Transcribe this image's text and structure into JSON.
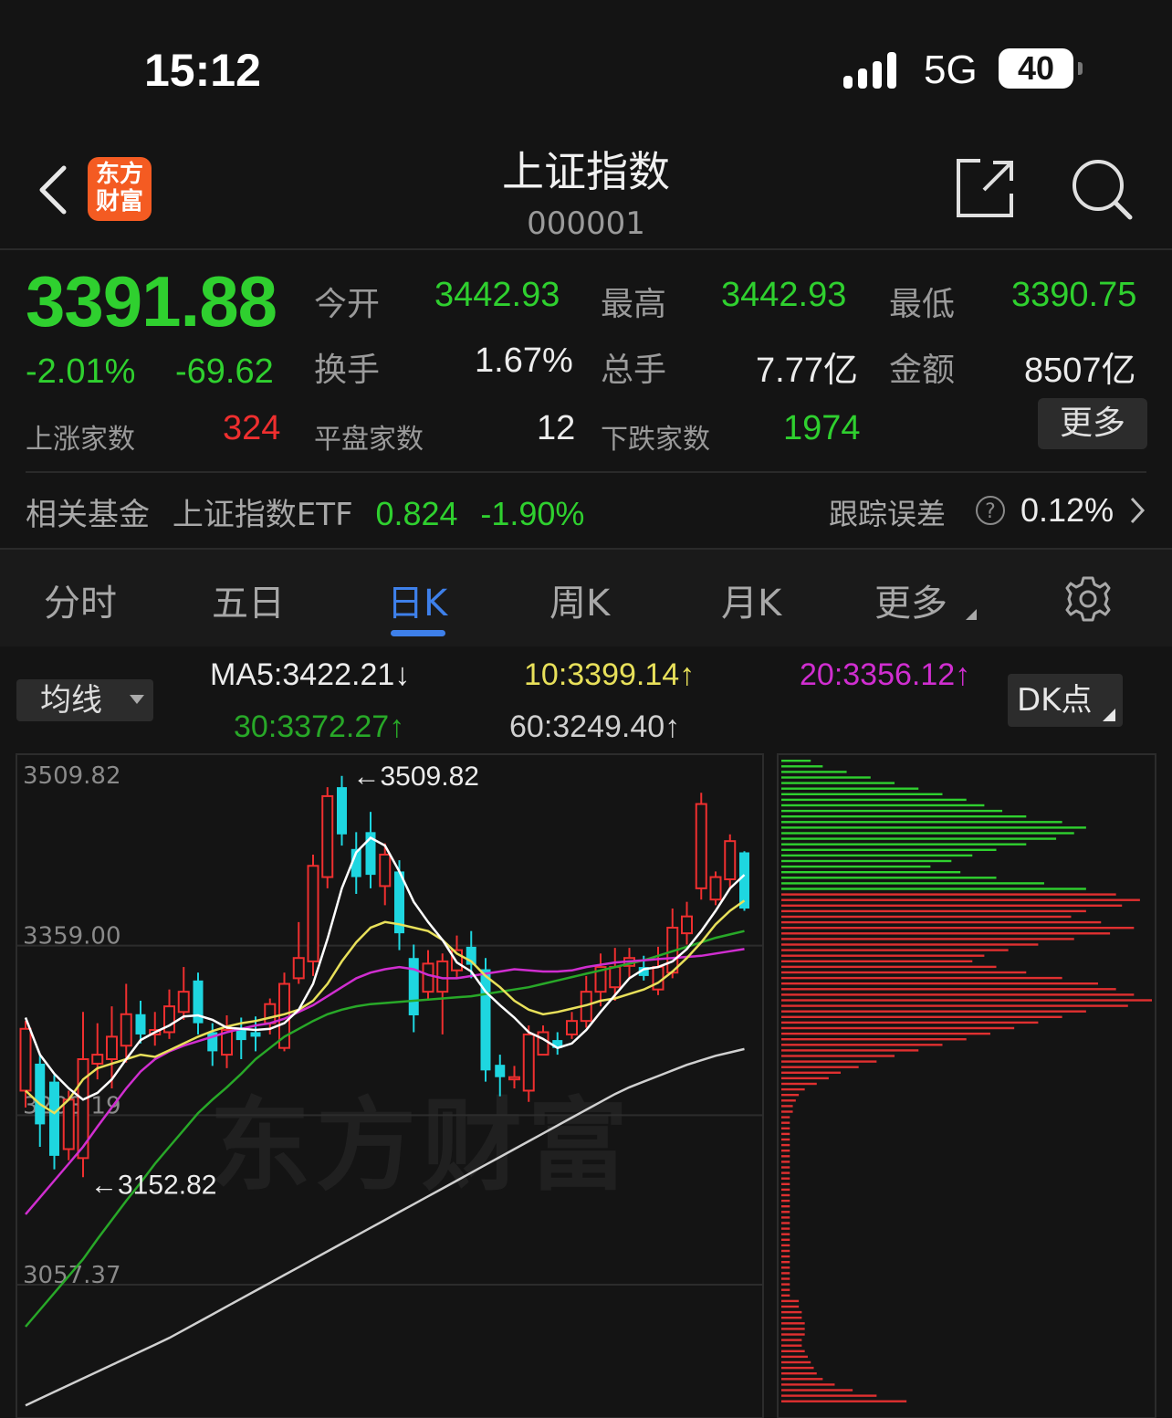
{
  "status_bar": {
    "time": "15:12",
    "network": "5G",
    "battery": "40"
  },
  "header": {
    "back_icon": "chevron-left-icon",
    "logo_line1": "东方",
    "logo_line2": "财富",
    "title": "上证指数",
    "code": "000001",
    "share_icon": "share-icon",
    "search_icon": "search-icon"
  },
  "quote": {
    "price": "3391.88",
    "change_pct": "-2.01%",
    "change": "-69.62",
    "open_label": "今开",
    "open": "3442.93",
    "high_label": "最高",
    "high": "3442.93",
    "low_label": "最低",
    "low": "3390.75",
    "turnover_label": "换手",
    "turnover": "1.67%",
    "volume_label": "总手",
    "volume": "7.77亿",
    "amount_label": "金额",
    "amount": "8507亿",
    "up_label": "上涨家数",
    "up": "324",
    "flat_label": "平盘家数",
    "flat": "12",
    "down_label": "下跌家数",
    "down": "1974",
    "more": "更多"
  },
  "fund": {
    "label": "相关基金",
    "name": "上证指数ETF",
    "price": "0.824",
    "change": "-1.90%",
    "err_label": "跟踪误差",
    "err": "0.12%"
  },
  "tabs": [
    {
      "label": "分时"
    },
    {
      "label": "五日"
    },
    {
      "label": "日K"
    },
    {
      "label": "周K"
    },
    {
      "label": "月K"
    },
    {
      "label": "更多"
    }
  ],
  "active_tab": "日K",
  "ma": {
    "select": "均线",
    "ma5": "MA5:3422.21",
    "ma5_dir": "↓",
    "ma10": "10:3399.14",
    "ma10_dir": "↑",
    "ma20": "20:3356.12",
    "ma20_dir": "↑",
    "ma30": "30:3372.27",
    "ma30_dir": "↑",
    "ma60": "60:3249.40",
    "ma60_dir": "↑",
    "dk": "DK点"
  },
  "colors": {
    "up": "#ef2f2f",
    "down": "#2fd02f",
    "flat_candle_down": "#1ed6e0",
    "ma5": "#ffffff",
    "ma10": "#e8e05a",
    "ma20": "#d02ed0",
    "ma30": "#28a828",
    "ma60": "#d0d0d0",
    "accent": "#3e80ea"
  },
  "chart_data": {
    "type": "candlestick",
    "y_axis_labels": [
      "3509.82",
      "3359.00",
      "3208.19",
      "3057.37"
    ],
    "annotations": {
      "max": "3509.82",
      "min": "3152.82"
    },
    "watermark": "东方财富",
    "candles": [
      {
        "o": 3230,
        "c": 3285,
        "h": 3292,
        "l": 3215
      },
      {
        "o": 3254,
        "c": 3200,
        "h": 3262,
        "l": 3180
      },
      {
        "o": 3238,
        "c": 3172,
        "h": 3244,
        "l": 3160
      },
      {
        "o": 3178,
        "c": 3222,
        "h": 3230,
        "l": 3168
      },
      {
        "o": 3170,
        "c": 3258,
        "h": 3300,
        "l": 3153
      },
      {
        "o": 3254,
        "c": 3262,
        "h": 3290,
        "l": 3240
      },
      {
        "o": 3258,
        "c": 3278,
        "h": 3305,
        "l": 3232
      },
      {
        "o": 3270,
        "c": 3298,
        "h": 3325,
        "l": 3255
      },
      {
        "o": 3298,
        "c": 3280,
        "h": 3310,
        "l": 3272
      },
      {
        "o": 3280,
        "c": 3284,
        "h": 3300,
        "l": 3270
      },
      {
        "o": 3282,
        "c": 3305,
        "h": 3320,
        "l": 3276
      },
      {
        "o": 3300,
        "c": 3318,
        "h": 3340,
        "l": 3293
      },
      {
        "o": 3328,
        "c": 3290,
        "h": 3335,
        "l": 3280
      },
      {
        "o": 3282,
        "c": 3265,
        "h": 3290,
        "l": 3252
      },
      {
        "o": 3262,
        "c": 3284,
        "h": 3297,
        "l": 3250
      },
      {
        "o": 3285,
        "c": 3275,
        "h": 3295,
        "l": 3258
      },
      {
        "o": 3282,
        "c": 3278,
        "h": 3296,
        "l": 3265
      },
      {
        "o": 3290,
        "c": 3307,
        "h": 3312,
        "l": 3280
      },
      {
        "o": 3268,
        "c": 3325,
        "h": 3335,
        "l": 3265
      },
      {
        "o": 3330,
        "c": 3348,
        "h": 3380,
        "l": 3325
      },
      {
        "o": 3345,
        "c": 3430,
        "h": 3440,
        "l": 3332
      },
      {
        "o": 3420,
        "c": 3492,
        "h": 3500,
        "l": 3410
      },
      {
        "o": 3500,
        "c": 3458,
        "h": 3510,
        "l": 3448
      },
      {
        "o": 3445,
        "c": 3420,
        "h": 3460,
        "l": 3405
      },
      {
        "o": 3460,
        "c": 3422,
        "h": 3478,
        "l": 3410
      },
      {
        "o": 3412,
        "c": 3440,
        "h": 3450,
        "l": 3395
      },
      {
        "o": 3425,
        "c": 3370,
        "h": 3435,
        "l": 3355
      },
      {
        "o": 3348,
        "c": 3297,
        "h": 3360,
        "l": 3282
      },
      {
        "o": 3318,
        "c": 3343,
        "h": 3355,
        "l": 3310
      },
      {
        "o": 3318,
        "c": 3345,
        "h": 3352,
        "l": 3280
      },
      {
        "o": 3337,
        "c": 3355,
        "h": 3368,
        "l": 3330
      },
      {
        "o": 3358,
        "c": 3342,
        "h": 3372,
        "l": 3330
      },
      {
        "o": 3338,
        "c": 3248,
        "h": 3348,
        "l": 3238
      },
      {
        "o": 3253,
        "c": 3242,
        "h": 3262,
        "l": 3225
      },
      {
        "o": 3240,
        "c": 3242,
        "h": 3252,
        "l": 3232
      },
      {
        "o": 3230,
        "c": 3280,
        "h": 3288,
        "l": 3220
      },
      {
        "o": 3262,
        "c": 3282,
        "h": 3288,
        "l": 3266
      },
      {
        "o": 3275,
        "c": 3268,
        "h": 3282,
        "l": 3262
      },
      {
        "o": 3280,
        "c": 3292,
        "h": 3300,
        "l": 3276
      },
      {
        "o": 3292,
        "c": 3318,
        "h": 3332,
        "l": 3286
      },
      {
        "o": 3318,
        "c": 3340,
        "h": 3352,
        "l": 3305
      },
      {
        "o": 3322,
        "c": 3340,
        "h": 3357,
        "l": 3310
      },
      {
        "o": 3341,
        "c": 3348,
        "h": 3357,
        "l": 3330
      },
      {
        "o": 3340,
        "c": 3332,
        "h": 3350,
        "l": 3328
      },
      {
        "o": 3320,
        "c": 3340,
        "h": 3358,
        "l": 3315
      },
      {
        "o": 3335,
        "c": 3375,
        "h": 3392,
        "l": 3330
      },
      {
        "o": 3370,
        "c": 3385,
        "h": 3398,
        "l": 3360
      },
      {
        "o": 3410,
        "c": 3485,
        "h": 3495,
        "l": 3400
      },
      {
        "o": 3400,
        "c": 3420,
        "h": 3425,
        "l": 3395
      },
      {
        "o": 3418,
        "c": 3452,
        "h": 3458,
        "l": 3410
      },
      {
        "o": 3442,
        "c": 3392,
        "h": 3443,
        "l": 3390
      }
    ],
    "ma5": [
      3295,
      3262,
      3245,
      3232,
      3222,
      3228,
      3240,
      3258,
      3275,
      3282,
      3288,
      3296,
      3297,
      3293,
      3286,
      3285,
      3284,
      3285,
      3290,
      3302,
      3325,
      3365,
      3410,
      3442,
      3455,
      3448,
      3425,
      3398,
      3380,
      3364,
      3344,
      3336,
      3318,
      3306,
      3295,
      3282,
      3276,
      3268,
      3272,
      3284,
      3300,
      3315,
      3330,
      3338,
      3340,
      3345,
      3356,
      3372,
      3390,
      3410,
      3422
    ],
    "ma10": [
      3230,
      3218,
      3210,
      3222,
      3240,
      3250,
      3254,
      3258,
      3262,
      3260,
      3266,
      3272,
      3278,
      3283,
      3287,
      3290,
      3292,
      3295,
      3298,
      3302,
      3310,
      3325,
      3345,
      3362,
      3375,
      3380,
      3378,
      3375,
      3372,
      3364,
      3352,
      3345,
      3332,
      3322,
      3310,
      3302,
      3298,
      3300,
      3303,
      3306,
      3310,
      3312,
      3316,
      3320,
      3326,
      3336,
      3348,
      3362,
      3378,
      3390,
      3399
    ],
    "ma20": [
      3120,
      3135,
      3150,
      3165,
      3180,
      3198,
      3215,
      3232,
      3247,
      3258,
      3265,
      3270,
      3274,
      3278,
      3282,
      3285,
      3288,
      3290,
      3294,
      3300,
      3306,
      3314,
      3322,
      3330,
      3335,
      3338,
      3340,
      3338,
      3333,
      3330,
      3330,
      3332,
      3334,
      3336,
      3338,
      3337,
      3336,
      3336,
      3337,
      3340,
      3342,
      3344,
      3345,
      3346,
      3347,
      3348,
      3349,
      3350,
      3352,
      3354,
      3356
    ],
    "ma30": [
      3020,
      3035,
      3050,
      3065,
      3080,
      3098,
      3115,
      3132,
      3148,
      3165,
      3180,
      3195,
      3210,
      3222,
      3233,
      3245,
      3258,
      3268,
      3278,
      3285,
      3292,
      3298,
      3302,
      3305,
      3307,
      3308,
      3309,
      3310,
      3311,
      3312,
      3313,
      3314,
      3316,
      3318,
      3320,
      3322,
      3325,
      3328,
      3331,
      3334,
      3337,
      3340,
      3343,
      3346,
      3350,
      3354,
      3358,
      3362,
      3366,
      3369,
      3372
    ],
    "ma60": [
      2950,
      2956,
      2962,
      2968,
      2974,
      2980,
      2986,
      2992,
      2998,
      3004,
      3010,
      3017,
      3024,
      3031,
      3038,
      3045,
      3052,
      3059,
      3066,
      3073,
      3080,
      3087,
      3094,
      3101,
      3108,
      3115,
      3122,
      3129,
      3136,
      3143,
      3150,
      3157,
      3164,
      3171,
      3178,
      3185,
      3192,
      3199,
      3206,
      3213,
      3220,
      3227,
      3233,
      3238,
      3243,
      3248,
      3253,
      3257,
      3261,
      3264,
      3267
    ],
    "volume_profile": [
      8,
      12,
      20,
      28,
      36,
      44,
      52,
      60,
      66,
      72,
      80,
      92,
      100,
      96,
      90,
      80,
      70,
      62,
      55,
      48,
      58,
      70,
      86,
      100,
      110,
      118,
      112,
      100,
      95,
      105,
      116,
      108,
      96,
      84,
      74,
      66,
      62,
      70,
      80,
      92,
      104,
      110,
      116,
      122,
      114,
      100,
      92,
      84,
      76,
      68,
      60,
      52,
      44,
      36,
      30,
      24,
      18,
      14,
      10,
      6,
      4,
      3,
      2,
      2,
      1,
      1,
      1,
      1,
      1,
      1,
      1,
      1,
      1,
      1,
      1,
      1,
      1,
      1,
      1,
      1,
      1,
      1,
      1,
      1,
      1,
      1,
      1,
      1,
      1,
      1,
      1,
      1,
      1,
      1,
      1,
      1,
      1,
      4,
      4,
      5,
      5,
      6,
      6,
      6,
      5,
      5,
      6,
      7,
      8,
      9,
      10,
      12,
      16,
      22,
      30,
      40
    ]
  }
}
